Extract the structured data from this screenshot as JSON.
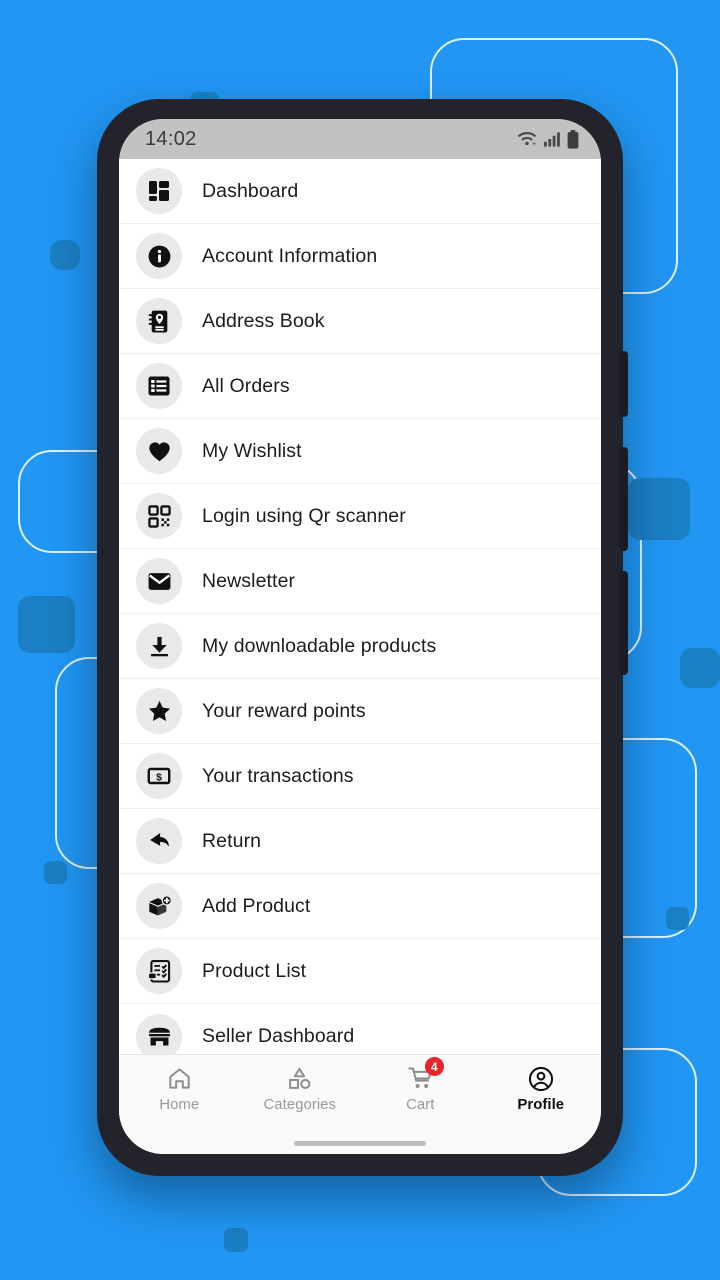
{
  "theme": {
    "background_blue": "#2196f3",
    "square_blue": "#1b7fc4",
    "outline_white": "#ffffff",
    "phone_frame": "#23232b",
    "badge_red": "#e8262a",
    "icon_circle_gray": "#e9e9e9",
    "statusbar_gray": "#c2c2c2"
  },
  "statusbar": {
    "time": "14:02",
    "icons": [
      "wifi-icon",
      "signal-icon",
      "battery-icon"
    ]
  },
  "menu": {
    "items": [
      {
        "label": "Dashboard",
        "icon": "dashboard-grid-icon"
      },
      {
        "label": "Account Information",
        "icon": "info-circle-icon"
      },
      {
        "label": "Address Book",
        "icon": "address-book-icon"
      },
      {
        "label": "All Orders",
        "icon": "list-orders-icon"
      },
      {
        "label": "My Wishlist",
        "icon": "heart-icon"
      },
      {
        "label": "Login using Qr scanner",
        "icon": "qr-code-icon"
      },
      {
        "label": "Newsletter",
        "icon": "envelope-icon"
      },
      {
        "label": "My downloadable products",
        "icon": "download-icon"
      },
      {
        "label": "Your reward points",
        "icon": "star-icon"
      },
      {
        "label": "Your transactions",
        "icon": "money-note-icon"
      },
      {
        "label": "Return",
        "icon": "back-arrow-icon"
      },
      {
        "label": "Add Product",
        "icon": "box-plus-icon"
      },
      {
        "label": "Product List",
        "icon": "clipboard-check-icon"
      },
      {
        "label": "Seller Dashboard",
        "icon": "storefront-icon"
      }
    ]
  },
  "bottom_nav": {
    "items": [
      {
        "label": "Home",
        "icon": "home-icon",
        "active": false,
        "badge": ""
      },
      {
        "label": "Categories",
        "icon": "shapes-icon",
        "active": false,
        "badge": ""
      },
      {
        "label": "Cart",
        "icon": "cart-icon",
        "active": false,
        "badge": "4"
      },
      {
        "label": "Profile",
        "icon": "person-circle-icon",
        "active": true,
        "badge": ""
      }
    ]
  }
}
